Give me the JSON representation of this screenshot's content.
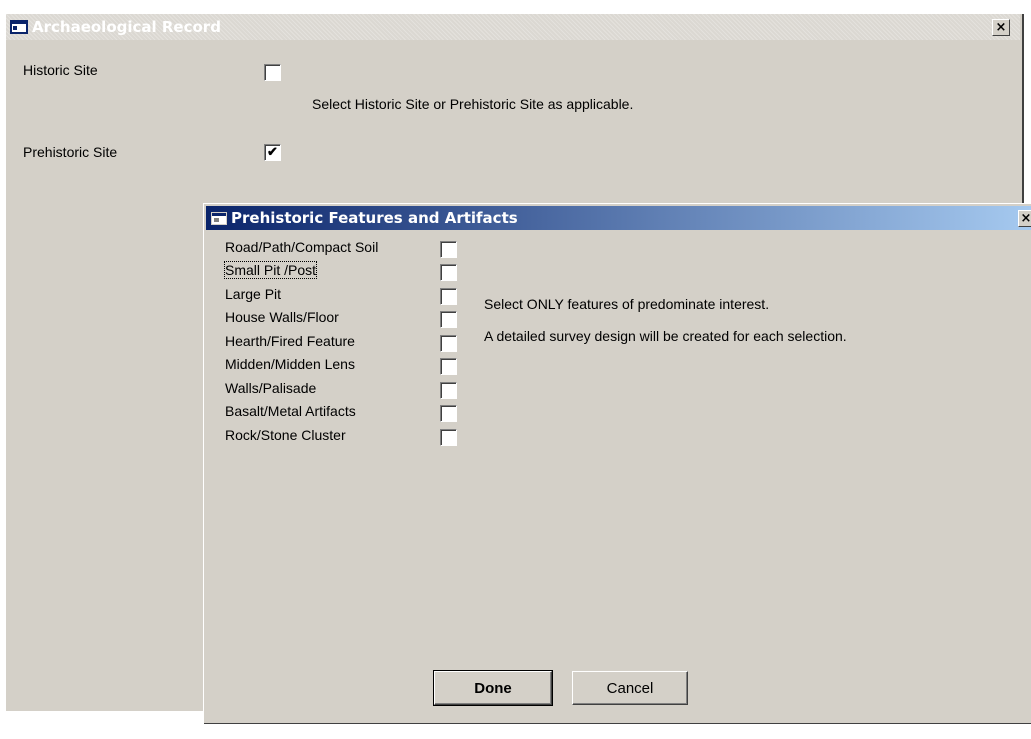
{
  "main_window": {
    "title": "Archaeological Record",
    "close_glyph": "×",
    "historic_site_label": "Historic Site",
    "historic_site_checked": false,
    "prehistoric_site_label": "Prehistoric Site",
    "prehistoric_site_checked": true,
    "instruction": "Select Historic Site or Prehistoric Site as applicable.",
    "check_glyph": "✔"
  },
  "dialog": {
    "title": "Prehistoric Features and Artifacts",
    "close_glyph": "×",
    "features": [
      {
        "label": "Road/Path/Compact Soil",
        "checked": false
      },
      {
        "label": "Small Pit /Post",
        "checked": false
      },
      {
        "label": "Large Pit",
        "checked": false
      },
      {
        "label": "House Walls/Floor",
        "checked": false
      },
      {
        "label": "Hearth/Fired Feature",
        "checked": false
      },
      {
        "label": "Midden/Midden Lens",
        "checked": false
      },
      {
        "label": "Walls/Palisade",
        "checked": false
      },
      {
        "label": "Basalt/Metal Artifacts",
        "checked": false
      },
      {
        "label": "Rock/Stone  Cluster",
        "checked": false
      }
    ],
    "note_1": "Select ONLY features of predominate interest.",
    "note_2": "A detailed survey design will be created for each selection.",
    "done_label": "Done",
    "cancel_label": "Cancel"
  },
  "colors": {
    "dialog_title_start": "#0a246a",
    "dialog_title_end": "#a6caf0",
    "window_face": "#d4d0c8"
  }
}
